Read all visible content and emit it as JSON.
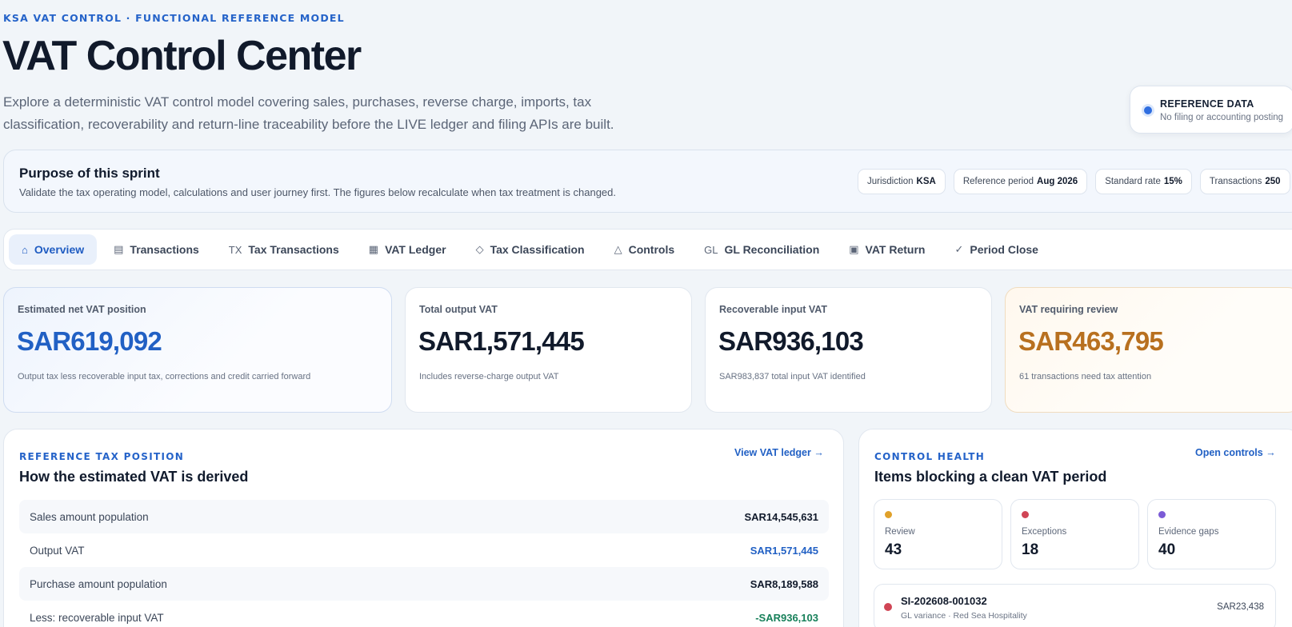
{
  "header": {
    "eyebrow": "KSA VAT CONTROL · FUNCTIONAL REFERENCE MODEL",
    "title": "VAT Control Center",
    "subtitle": "Explore a deterministic VAT control model covering sales, purchases, reverse charge, imports, tax classification, recoverability and return-line traceability before the LIVE ledger and filing APIs are built."
  },
  "reference": {
    "title": "REFERENCE DATA",
    "subtitle": "No filing or accounting posting"
  },
  "purpose": {
    "title": "Purpose of this sprint",
    "subtitle": "Validate the tax operating model, calculations and user journey first. The figures below recalculate when tax treatment is changed.",
    "chips": [
      {
        "label": "Jurisdiction",
        "value": "KSA"
      },
      {
        "label": "Reference period",
        "value": "Aug 2026"
      },
      {
        "label": "Standard rate",
        "value": "15%"
      },
      {
        "label": "Transactions",
        "value": "250"
      }
    ]
  },
  "tabs": [
    {
      "icon": "⌂",
      "label": "Overview"
    },
    {
      "icon": "▤",
      "label": "Transactions"
    },
    {
      "icon": "TX",
      "label": "Tax Transactions"
    },
    {
      "icon": "▦",
      "label": "VAT Ledger"
    },
    {
      "icon": "◇",
      "label": "Tax Classification"
    },
    {
      "icon": "△",
      "label": "Controls"
    },
    {
      "icon": "GL",
      "label": "GL Reconciliation"
    },
    {
      "icon": "▣",
      "label": "VAT Return"
    },
    {
      "icon": "✓",
      "label": "Period Close"
    }
  ],
  "kpis": [
    {
      "label": "Estimated net VAT position",
      "value": "SAR619,092",
      "note": "Output tax less recoverable input tax, corrections and credit carried forward"
    },
    {
      "label": "Total output VAT",
      "value": "SAR1,571,445",
      "note": "Includes reverse-charge output VAT"
    },
    {
      "label": "Recoverable input VAT",
      "value": "SAR936,103",
      "note": "SAR983,837 total input VAT identified"
    },
    {
      "label": "VAT requiring review",
      "value": "SAR463,795",
      "note": "61 transactions need tax attention"
    }
  ],
  "tax_position": {
    "eyebrow": "REFERENCE TAX POSITION",
    "title": "How the estimated VAT is derived",
    "link": "View VAT ledger →",
    "rows": [
      {
        "label": "Sales amount population",
        "value": "SAR14,545,631"
      },
      {
        "label": "Output VAT",
        "value": "SAR1,571,445"
      },
      {
        "label": "Purchase amount population",
        "value": "SAR8,189,588"
      },
      {
        "label": "Less: recoverable input VAT",
        "value": "-SAR936,103"
      }
    ]
  },
  "control_health": {
    "eyebrow": "CONTROL HEALTH",
    "title": "Items blocking a clean VAT period",
    "link": "Open controls →",
    "cards": [
      {
        "label": "Review",
        "count": "43",
        "color": "#e0a12a"
      },
      {
        "label": "Exceptions",
        "count": "18",
        "color": "#d04555"
      },
      {
        "label": "Evidence gaps",
        "count": "40",
        "color": "#7b5bd6"
      }
    ],
    "issue": {
      "id": "SI-202608-001032",
      "detail": "GL variance · Red Sea Hospitality",
      "amount": "SAR23,438"
    }
  }
}
